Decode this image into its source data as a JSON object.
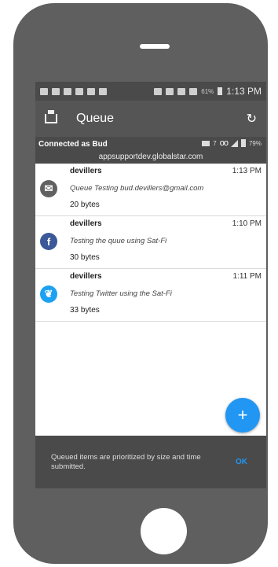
{
  "status_bar": {
    "battery_pct": "61%",
    "time": "1:13 PM",
    "icons": [
      "gmail-icon",
      "facebook-icon",
      "mail-icon",
      "twitter-icon",
      "facebook-icon",
      "image-icon",
      "bluetooth-icon",
      "alarm-icon",
      "wifi-icon",
      "signal-icon",
      "battery-icon"
    ]
  },
  "app_bar": {
    "title": "Queue"
  },
  "connection": {
    "label": "Connected as Bud",
    "host": "appsupportdev.globalstar.com",
    "mail_count": "7",
    "battery_pct": "79%"
  },
  "messages": [
    {
      "sender": "devillers",
      "time": "1:13 PM",
      "text": "Queue Testing bud.devillers@gmail.com",
      "size": "20 bytes",
      "channel": "email",
      "color": "#616161"
    },
    {
      "sender": "devillers",
      "time": "1:10 PM",
      "text": "Testing the quue using Sat-Fi",
      "size": "30 bytes",
      "channel": "facebook",
      "color": "#3b5998"
    },
    {
      "sender": "devillers",
      "time": "1:11 PM",
      "text": "Testing Twitter using the Sat-Fi",
      "size": "33 bytes",
      "channel": "twitter",
      "color": "#1da1f2"
    }
  ],
  "snackbar": {
    "text": "Queued items are prioritized by size and time submitted.",
    "action": "OK"
  }
}
